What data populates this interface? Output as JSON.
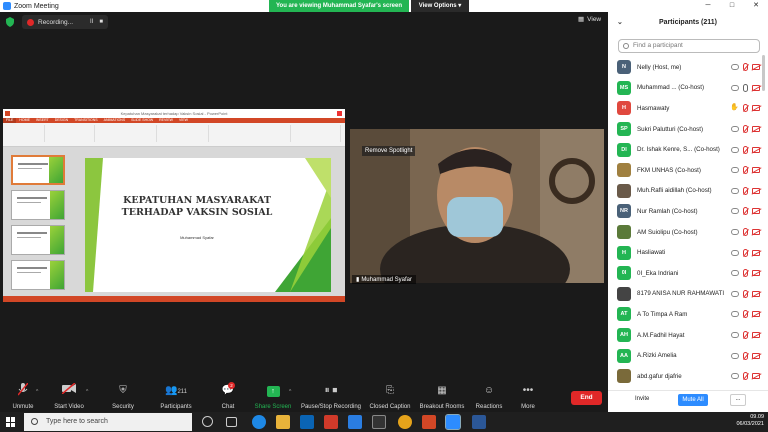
{
  "window": {
    "title": "Zoom Meeting"
  },
  "banner": {
    "text": "You are viewing Muhammad Syafar's screen",
    "view_options": "View Options"
  },
  "recording": {
    "label": "Recording...",
    "pause": "II",
    "stop": "■"
  },
  "view": {
    "label": "View"
  },
  "presentation": {
    "app_title": "Kepatuhan Masyarakat terhadap Vaksin Sosial - PowerPoint",
    "tabs": [
      "FILE",
      "HOME",
      "INSERT",
      "DESIGN",
      "TRANSITIONS",
      "ANIMATIONS",
      "SLIDE SHOW",
      "REVIEW",
      "VIEW"
    ],
    "slide_title": "KEPATUHAN MASYARAKAT TERHADAP VAKSIN SOSIAL",
    "slide_author": "Muhammad Syafar"
  },
  "camera": {
    "remove_spotlight": "Remove Spotlight",
    "name": "Muhammad Syafar"
  },
  "participants_panel": {
    "title": "Participants (211)",
    "search_placeholder": "Find a participant",
    "items": [
      {
        "initials": "N",
        "name": "Nelly (Host, me)",
        "color": "#4a6178",
        "hand": false,
        "mic_on": false
      },
      {
        "initials": "MS",
        "name": "Muhammad ...   (Co-host)",
        "color": "#23b553",
        "hand": false,
        "mic_on": true
      },
      {
        "initials": "H",
        "name": "Hasmawaty",
        "color": "#e0483e",
        "hand": true,
        "mic_on": false
      },
      {
        "initials": "SP",
        "name": "Sukri Palutturi (Co-host)",
        "color": "#23b553",
        "hand": false,
        "mic_on": false
      },
      {
        "initials": "DI",
        "name": "Dr. Ishak Kenre, S...   (Co-host)",
        "color": "#23b553",
        "hand": false,
        "mic_on": false
      },
      {
        "initials": "",
        "name": "FKM UNHAS (Co-host)",
        "color": "#a08040",
        "hand": false,
        "mic_on": false
      },
      {
        "initials": "",
        "name": "Muh.Rafli aidillah (Co-host)",
        "color": "#6a5a4a",
        "hand": false,
        "mic_on": false
      },
      {
        "initials": "NR",
        "name": "Nur Ramlah (Co-host)",
        "color": "#4a6178",
        "hand": false,
        "mic_on": false
      },
      {
        "initials": "",
        "name": "AM Suiolipu (Co-host)",
        "color": "#5b7a3a",
        "hand": false,
        "mic_on": false
      },
      {
        "initials": "H",
        "name": "Hasliawati",
        "color": "#23b553",
        "hand": false,
        "mic_on": false
      },
      {
        "initials": "0I",
        "name": "0I_Eka Indriani",
        "color": "#23b553",
        "hand": false,
        "mic_on": false
      },
      {
        "initials": "",
        "name": "8179 ANISA NUR RAHMAWATI",
        "color": "#444",
        "hand": false,
        "mic_on": false
      },
      {
        "initials": "AT",
        "name": "A To Timpa A Ram",
        "color": "#23b553",
        "hand": false,
        "mic_on": false
      },
      {
        "initials": "AH",
        "name": "A.M.Fadhil Hayat",
        "color": "#23b553",
        "hand": false,
        "mic_on": false
      },
      {
        "initials": "AA",
        "name": "A.Rizki Amelia",
        "color": "#23b553",
        "hand": false,
        "mic_on": false
      },
      {
        "initials": "",
        "name": "abd.gafur djafrie",
        "color": "#7a6a3a",
        "hand": false,
        "mic_on": false
      }
    ],
    "invite": "Invite",
    "mute_all": "Mute All",
    "more": "..."
  },
  "toolbar": {
    "unmute": "Unmute",
    "start_video": "Start Video",
    "security": "Security",
    "participants": "Participants",
    "participants_count": "211",
    "chat": "Chat",
    "chat_badge": "2",
    "share_screen": "Share Screen",
    "pause_recording": "Pause/Stop Recording",
    "closed_caption": "Closed Caption",
    "breakout_rooms": "Breakout Rooms",
    "reactions": "Reactions",
    "more": "More",
    "end": "End"
  },
  "taskbar": {
    "search_placeholder": "Type here to search",
    "time": "09.09",
    "date": "06/03/2021"
  }
}
